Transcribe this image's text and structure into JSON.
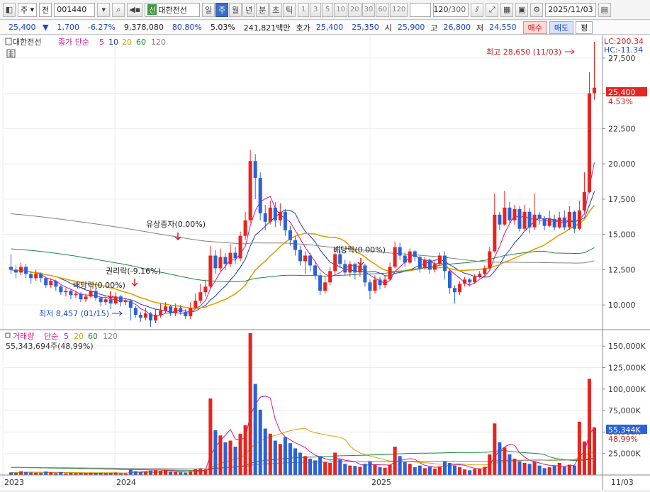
{
  "toolbar": {
    "market": "주",
    "type": "전",
    "code": "001440",
    "name_badge": "신",
    "name": "대한전선",
    "periods": [
      "일",
      "주",
      "월",
      "년",
      "분",
      "초",
      "틱"
    ],
    "active_period": "주",
    "intervals": [
      "1",
      "3",
      "5",
      "10",
      "20",
      "30",
      "60",
      "120"
    ],
    "count": "120",
    "count_total": "/300",
    "date": "2025/11/03"
  },
  "quote": {
    "price": "25,400",
    "change": "1,700",
    "change_rate": "-6.27%",
    "volume": "9,378,080",
    "volume_ratio": "80.80%",
    "turnover": "5.03%",
    "amount": "241,821백만",
    "ask_label": "호가",
    "ask": "25,400",
    "bid": "25,350",
    "open_label": "시",
    "open": "25,900",
    "high_label": "고",
    "high": "26,800",
    "low_label": "저",
    "low": "24,550",
    "buy_button": "매수",
    "sell_button": "매도",
    "eval_button": "평"
  },
  "price_panel": {
    "legend_name": "대한전선",
    "legend_ma_title": "종가 단순",
    "ma_periods": [
      "5",
      "10",
      "20",
      "60",
      "120"
    ],
    "lc": "LC:200.34",
    "hc": "HC:-11.34",
    "current_label": "25,400",
    "current_change": "4.53%",
    "high_note": "최고 28,650 (11/03)",
    "low_note": "최저 8,457 (01/15)",
    "events": [
      {
        "label": "권리락(-9.16%)"
      },
      {
        "label": "배당락(0.00%)"
      },
      {
        "label": "유상증자(0.00%)"
      },
      {
        "label": "배당락(0.00%)"
      }
    ],
    "y_ticks": [
      "27,500",
      "25,000",
      "22,500",
      "20,000",
      "17,500",
      "15,000",
      "12,500",
      "10,000"
    ]
  },
  "volume_panel": {
    "legend_title": "거래량",
    "legend_ma_title": "단순",
    "ma_periods": [
      "5",
      "20",
      "60",
      "120"
    ],
    "summary": "55,343,694주(48,99%)",
    "current_label": "55,344K",
    "current_pct": "48,99%",
    "y_ticks": [
      "150,000K",
      "125,000K",
      "100,000K",
      "75,000K",
      "50,000K",
      "25,000K"
    ]
  },
  "x_axis": [
    "2023",
    "2024",
    "2025",
    "11/03"
  ],
  "colors": {
    "up": "#e8241f",
    "down": "#2a62d8",
    "ma5": "#d2189a",
    "ma10": "#1f3bb0",
    "ma20": "#e0a000",
    "ma60": "#1a8a3a",
    "ma120": "#808080"
  },
  "chart_data": {
    "type": "candlestick",
    "price_range": [
      8400,
      28700
    ],
    "volume_range": [
      0,
      165000
    ],
    "candles": [
      [
        12700,
        12500,
        13600,
        12200,
        3000
      ],
      [
        12500,
        12300,
        12800,
        11900,
        2500
      ],
      [
        12300,
        12700,
        13000,
        12100,
        4200
      ],
      [
        12700,
        12200,
        12900,
        11900,
        3500
      ],
      [
        12200,
        11900,
        12400,
        11500,
        2800
      ],
      [
        11900,
        12200,
        12500,
        11700,
        2600
      ],
      [
        12200,
        11900,
        12300,
        11600,
        2400
      ],
      [
        11900,
        11400,
        12000,
        11200,
        4000
      ],
      [
        11400,
        11700,
        11900,
        11200,
        3100
      ],
      [
        11700,
        11300,
        11800,
        11000,
        2200
      ],
      [
        11300,
        10900,
        11400,
        10700,
        3300
      ],
      [
        10900,
        11000,
        11200,
        10600,
        2000
      ],
      [
        11000,
        10700,
        11100,
        10400,
        2500
      ],
      [
        10700,
        10800,
        11000,
        10500,
        1800
      ],
      [
        10800,
        10400,
        10900,
        10200,
        2100
      ],
      [
        10400,
        10600,
        10800,
        10200,
        1700
      ],
      [
        10600,
        11000,
        11300,
        10500,
        2600
      ],
      [
        11000,
        10500,
        11200,
        10300,
        2300
      ],
      [
        10500,
        10200,
        10600,
        9900,
        2400
      ],
      [
        10200,
        10400,
        10600,
        10000,
        1900
      ],
      [
        10400,
        10100,
        10500,
        9700,
        2200
      ],
      [
        10100,
        10600,
        10900,
        10000,
        2800
      ],
      [
        10600,
        10200,
        10700,
        9900,
        1900
      ],
      [
        10200,
        10300,
        10500,
        10000,
        1600
      ],
      [
        10300,
        9800,
        10400,
        8900,
        6200
      ],
      [
        9800,
        9300,
        9900,
        9100,
        4400
      ],
      [
        9300,
        9100,
        9500,
        8800,
        3600
      ],
      [
        9100,
        9400,
        9800,
        8900,
        4100
      ],
      [
        9400,
        8900,
        9500,
        8457,
        5100
      ],
      [
        8900,
        9300,
        9700,
        8700,
        5600
      ],
      [
        9300,
        9600,
        10100,
        9100,
        4800
      ],
      [
        9600,
        9900,
        10200,
        9400,
        6200
      ],
      [
        9900,
        9400,
        10000,
        9200,
        3900
      ],
      [
        9400,
        9800,
        10100,
        9200,
        3600
      ],
      [
        9800,
        9500,
        10000,
        9300,
        3100
      ],
      [
        9500,
        9200,
        9700,
        9000,
        2800
      ],
      [
        9200,
        9800,
        10200,
        9000,
        4500
      ],
      [
        9800,
        10300,
        10800,
        9700,
        6600
      ],
      [
        10300,
        10900,
        11500,
        10100,
        7800
      ],
      [
        10900,
        11300,
        11800,
        10600,
        6400
      ],
      [
        11300,
        13500,
        14200,
        11200,
        89000
      ],
      [
        13500,
        12600,
        13900,
        12200,
        52000
      ],
      [
        12600,
        13400,
        14000,
        12400,
        46000
      ],
      [
        13400,
        12900,
        13700,
        12500,
        38000
      ],
      [
        12900,
        13700,
        14300,
        12700,
        40000
      ],
      [
        13700,
        13300,
        14100,
        12900,
        33000
      ],
      [
        13300,
        14900,
        15200,
        13100,
        48000
      ],
      [
        14900,
        16000,
        16600,
        14600,
        58000
      ],
      [
        16000,
        20200,
        21000,
        15800,
        165000
      ],
      [
        20200,
        19000,
        20700,
        17500,
        106000
      ],
      [
        19000,
        16500,
        19400,
        16000,
        76000
      ],
      [
        16500,
        15900,
        17100,
        15300,
        54000
      ],
      [
        15900,
        16900,
        17400,
        15700,
        48000
      ],
      [
        16900,
        16000,
        17300,
        15500,
        40000
      ],
      [
        16000,
        16600,
        17200,
        15600,
        36000
      ],
      [
        16600,
        15300,
        16800,
        14900,
        44000
      ],
      [
        15300,
        14600,
        15600,
        14200,
        37000
      ],
      [
        14600,
        13900,
        14900,
        13500,
        31000
      ],
      [
        13900,
        13100,
        14200,
        12800,
        26000
      ],
      [
        13100,
        13500,
        13800,
        12200,
        22000
      ],
      [
        13500,
        12800,
        13700,
        12400,
        19000
      ],
      [
        12800,
        12100,
        13000,
        11800,
        17000
      ],
      [
        12100,
        11000,
        12300,
        10700,
        22000
      ],
      [
        11000,
        11600,
        12000,
        10800,
        15000
      ],
      [
        11600,
        12400,
        12700,
        11400,
        14000
      ],
      [
        12400,
        13600,
        14000,
        12200,
        26000
      ],
      [
        13600,
        12900,
        13900,
        12600,
        18000
      ],
      [
        12900,
        12300,
        13200,
        12100,
        13000
      ],
      [
        12300,
        12900,
        13100,
        12000,
        11000
      ],
      [
        12900,
        12300,
        13000,
        11800,
        10500
      ],
      [
        12300,
        12800,
        13000,
        12000,
        9500
      ],
      [
        12800,
        11600,
        12900,
        11300,
        13000
      ],
      [
        11600,
        11000,
        11800,
        10400,
        16000
      ],
      [
        11000,
        11800,
        12100,
        10800,
        12000
      ],
      [
        11800,
        11400,
        12000,
        11100,
        9000
      ],
      [
        11400,
        11800,
        12100,
        11200,
        8500
      ],
      [
        11800,
        12700,
        13000,
        11700,
        12000
      ],
      [
        12700,
        14100,
        14500,
        12600,
        33000
      ],
      [
        14100,
        13500,
        14400,
        13200,
        22000
      ],
      [
        13500,
        13000,
        13700,
        12700,
        15000
      ],
      [
        13000,
        13800,
        14000,
        12900,
        13000
      ],
      [
        13800,
        13400,
        13900,
        13100,
        9000
      ],
      [
        13400,
        12600,
        13500,
        12300,
        11000
      ],
      [
        12600,
        13200,
        13400,
        12500,
        8000
      ],
      [
        13200,
        12500,
        13300,
        12200,
        9500
      ],
      [
        12500,
        12900,
        13100,
        12300,
        7500
      ],
      [
        12900,
        13500,
        13700,
        12800,
        10000
      ],
      [
        13500,
        12400,
        13800,
        11800,
        16000
      ],
      [
        12400,
        11200,
        12500,
        10800,
        14000
      ],
      [
        11200,
        10900,
        11400,
        10100,
        11000
      ],
      [
        10900,
        11500,
        11700,
        10700,
        9000
      ],
      [
        11500,
        11800,
        12000,
        11300,
        6500
      ],
      [
        11800,
        11600,
        11900,
        11300,
        5500
      ],
      [
        11600,
        12000,
        12200,
        11500,
        7000
      ],
      [
        12000,
        12200,
        12400,
        11900,
        7500
      ],
      [
        12200,
        12600,
        12800,
        12000,
        9500
      ],
      [
        12600,
        13800,
        14100,
        12500,
        24000
      ],
      [
        13800,
        16400,
        17900,
        13700,
        60000
      ],
      [
        16400,
        15700,
        16600,
        15300,
        38000
      ],
      [
        15700,
        16900,
        18100,
        15600,
        32000
      ],
      [
        16900,
        16000,
        17300,
        15800,
        24000
      ],
      [
        16000,
        16800,
        17100,
        15700,
        19000
      ],
      [
        16800,
        15400,
        17000,
        15200,
        16000
      ],
      [
        15400,
        16600,
        17100,
        15300,
        14000
      ],
      [
        16600,
        15500,
        16900,
        15100,
        13000
      ],
      [
        15500,
        16400,
        17900,
        15300,
        16000
      ],
      [
        16400,
        16100,
        16600,
        15700,
        11000
      ],
      [
        16100,
        15600,
        16300,
        15300,
        8000
      ],
      [
        15600,
        16100,
        16700,
        15500,
        9000
      ],
      [
        16100,
        15500,
        16400,
        15300,
        10500
      ],
      [
        15500,
        16200,
        16600,
        15400,
        14000
      ],
      [
        16200,
        15500,
        16700,
        15300,
        9500
      ],
      [
        15500,
        16600,
        17000,
        15300,
        12000
      ],
      [
        16600,
        15400,
        16700,
        15100,
        11000
      ],
      [
        15400,
        16700,
        17400,
        15300,
        62000
      ],
      [
        16700,
        18000,
        19400,
        16600,
        39000
      ],
      [
        18000,
        25000,
        26500,
        17900,
        112000
      ],
      [
        25000,
        25400,
        28650,
        24550,
        55344
      ]
    ],
    "ma5": [],
    "ma10": [],
    "ma20": [],
    "ma60": [],
    "ma120": [],
    "series": [
      {
        "name": "5",
        "role": "ma"
      },
      {
        "name": "10",
        "role": "ma"
      },
      {
        "name": "20",
        "role": "ma"
      },
      {
        "name": "60",
        "role": "ma"
      },
      {
        "name": "120",
        "role": "ma"
      }
    ]
  }
}
